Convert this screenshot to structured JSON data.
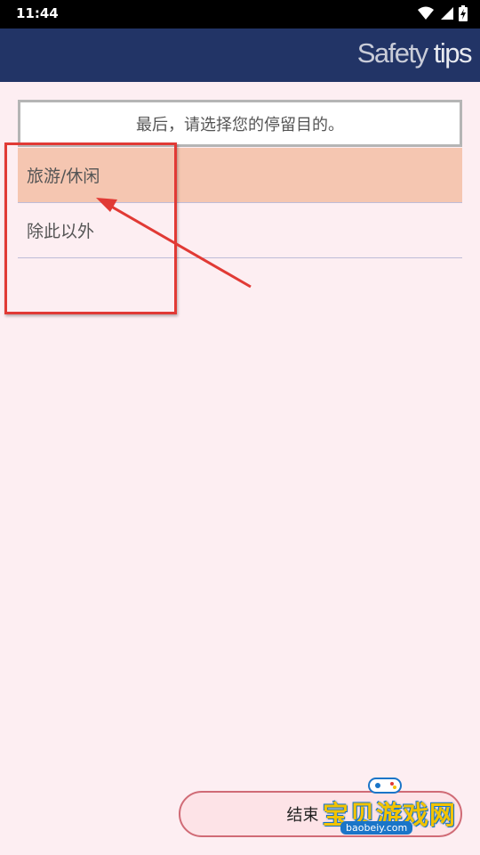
{
  "status_bar": {
    "time": "11:44",
    "icons": [
      "wifi-icon",
      "signal-icon",
      "battery-charging-icon"
    ]
  },
  "header": {
    "brand_light": "Safety",
    "brand_bold": "tips",
    "background": "#223466"
  },
  "question": {
    "text": "最后，请选择您的停留目的。"
  },
  "options": [
    {
      "label": "旅游/休闲",
      "selected": true
    },
    {
      "label": "除此以外",
      "selected": false
    }
  ],
  "end_button": {
    "label": "结束"
  },
  "watermark": {
    "text": "宝贝游戏网",
    "sub": "baobeiy.com"
  },
  "colors": {
    "background": "#fdeef2",
    "selected_option": "#f5c6b1",
    "annotation": "#e13a35"
  }
}
